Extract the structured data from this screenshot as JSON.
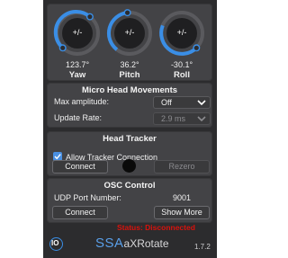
{
  "dials": {
    "button_label": "+/-",
    "yaw": {
      "label": "Yaw",
      "value": "123.7°"
    },
    "pitch": {
      "label": "Pitch",
      "value": "36.2°"
    },
    "roll": {
      "label": "Roll",
      "value": "-30.1°"
    }
  },
  "micro_head": {
    "title": "Micro Head Movements",
    "max_amplitude_label": "Max amplitude:",
    "max_amplitude_value": "Off",
    "update_rate_label": "Update Rate:",
    "update_rate_value": "2.9 ms"
  },
  "head_tracker": {
    "title": "Head Tracker",
    "allow_label": "Allow Tracker Connection",
    "allow_checked": true,
    "connect_label": "Connect",
    "rezero_label": "Rezero"
  },
  "osc": {
    "title": "OSC Control",
    "udp_label": "UDP Port Number:",
    "udp_value": "9001",
    "connect_label": "Connect",
    "show_more_label": "Show More",
    "status_text": "Status: Disconnected"
  },
  "footer": {
    "logo_text": "IO",
    "brand_main": "SSA",
    "brand_plugin": "aXRotate",
    "version": "1.7.2"
  },
  "colors": {
    "background": "#2c2c2e",
    "panel": "#434346",
    "accent": "#3a8ee6",
    "status": "#d9120c"
  }
}
